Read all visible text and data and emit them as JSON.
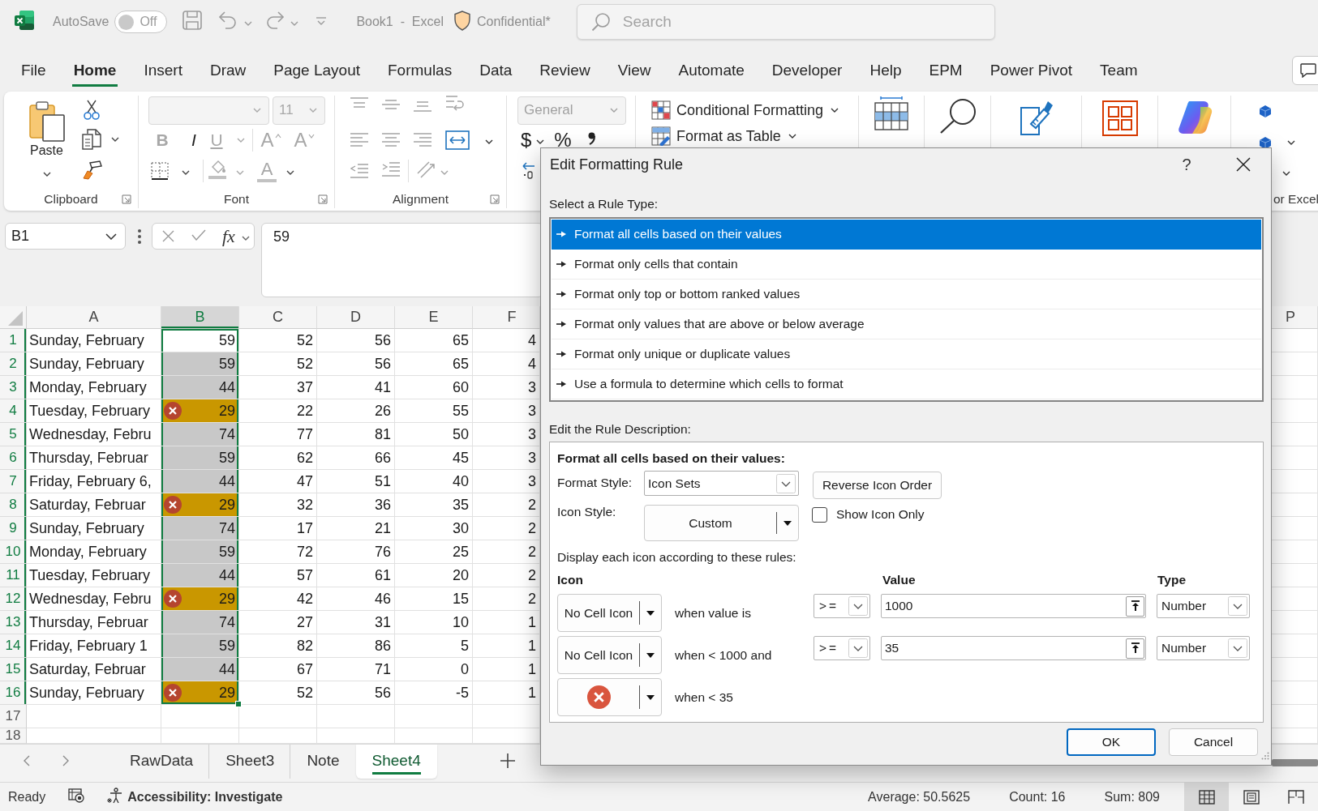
{
  "title_bar": {
    "autosave": {
      "label": "AutoSave",
      "on": false,
      "state_label": "Off"
    },
    "document": "Book1  -  Excel",
    "sensitivity": "Confidential*",
    "search": {
      "placeholder": "Search"
    }
  },
  "ribbon_tabs": [
    {
      "label": "File",
      "selected": false
    },
    {
      "label": "Home",
      "selected": true
    },
    {
      "label": "Insert",
      "selected": false
    },
    {
      "label": "Draw",
      "selected": false
    },
    {
      "label": "Page Layout",
      "selected": false
    },
    {
      "label": "Formulas",
      "selected": false
    },
    {
      "label": "Data",
      "selected": false
    },
    {
      "label": "Review",
      "selected": false
    },
    {
      "label": "View",
      "selected": false
    },
    {
      "label": "Automate",
      "selected": false
    },
    {
      "label": "Developer",
      "selected": false
    },
    {
      "label": "Help",
      "selected": false
    },
    {
      "label": "EPM",
      "selected": false
    },
    {
      "label": "Power Pivot",
      "selected": false
    },
    {
      "label": "Team",
      "selected": false
    }
  ],
  "ribbon": {
    "groups": [
      {
        "kind": "clipboard",
        "label": "Clipboard",
        "paste": "Paste"
      },
      {
        "kind": "font",
        "label": "Font",
        "disabled": true,
        "size": "11",
        "styles": [
          "B",
          "I",
          "U"
        ],
        "sizers": [
          "A",
          "A"
        ],
        "color_glyph": "A"
      },
      {
        "kind": "alignment",
        "label": "Alignment",
        "disabled": true
      },
      {
        "kind": "number",
        "format": {
          "value": "General",
          "disabled": true
        },
        "symbols": [
          "$",
          "%"
        ]
      },
      {
        "kind": "styles",
        "commands": [
          "Conditional Formatting",
          "Format as Table"
        ]
      },
      {
        "kind": "cells"
      },
      {
        "kind": "editing"
      },
      {
        "kind": "sensitivity"
      },
      {
        "kind": "addins"
      },
      {
        "kind": "copilot"
      },
      {
        "kind": "extension",
        "label": "or Excel"
      }
    ]
  },
  "formula_bar": {
    "name_box": "B1",
    "function_label": "fx",
    "formula": "59"
  },
  "grid": {
    "columns": [
      {
        "label": "A",
        "selected": false
      },
      {
        "label": "B",
        "selected": true
      },
      {
        "label": "C",
        "selected": false
      },
      {
        "label": "D",
        "selected": false
      },
      {
        "label": "E",
        "selected": false
      },
      {
        "label": "F",
        "selected": false
      }
    ],
    "far_columns": [
      {
        "label": "P",
        "selected": false
      }
    ],
    "rows": [
      {
        "label": "1",
        "selected": true,
        "cells": [
          "Sunday, February",
          {
            "value": "59",
            "flagged": false
          },
          "52",
          "56",
          "65",
          "4"
        ]
      },
      {
        "label": "2",
        "selected": true,
        "cells": [
          "Sunday, February",
          {
            "value": "59",
            "flagged": false
          },
          "52",
          "56",
          "65",
          "4"
        ]
      },
      {
        "label": "3",
        "selected": true,
        "cells": [
          "Monday, February",
          {
            "value": "44",
            "flagged": false
          },
          "37",
          "41",
          "60",
          "3"
        ]
      },
      {
        "label": "4",
        "selected": true,
        "cells": [
          "Tuesday, February",
          {
            "value": "29",
            "flagged": true
          },
          "22",
          "26",
          "55",
          "3"
        ]
      },
      {
        "label": "5",
        "selected": true,
        "cells": [
          "Wednesday, Febru",
          {
            "value": "74",
            "flagged": false
          },
          "77",
          "81",
          "50",
          "3"
        ]
      },
      {
        "label": "6",
        "selected": true,
        "cells": [
          "Thursday, Februar",
          {
            "value": "59",
            "flagged": false
          },
          "62",
          "66",
          "45",
          "3"
        ]
      },
      {
        "label": "7",
        "selected": true,
        "cells": [
          "Friday, February 6,",
          {
            "value": "44",
            "flagged": false
          },
          "47",
          "51",
          "40",
          "3"
        ]
      },
      {
        "label": "8",
        "selected": true,
        "cells": [
          "Saturday, Februar",
          {
            "value": "29",
            "flagged": true
          },
          "32",
          "36",
          "35",
          "2"
        ]
      },
      {
        "label": "9",
        "selected": true,
        "cells": [
          "Sunday, February",
          {
            "value": "74",
            "flagged": false
          },
          "17",
          "21",
          "30",
          "2"
        ]
      },
      {
        "label": "10",
        "selected": true,
        "cells": [
          "Monday, February",
          {
            "value": "59",
            "flagged": false
          },
          "72",
          "76",
          "25",
          "2"
        ]
      },
      {
        "label": "11",
        "selected": true,
        "cells": [
          "Tuesday, February",
          {
            "value": "44",
            "flagged": false
          },
          "57",
          "61",
          "20",
          "2"
        ]
      },
      {
        "label": "12",
        "selected": true,
        "cells": [
          "Wednesday, Febru",
          {
            "value": "29",
            "flagged": true
          },
          "42",
          "46",
          "15",
          "2"
        ]
      },
      {
        "label": "13",
        "selected": true,
        "cells": [
          "Thursday, Februar",
          {
            "value": "74",
            "flagged": false
          },
          "27",
          "31",
          "10",
          "1"
        ]
      },
      {
        "label": "14",
        "selected": true,
        "cells": [
          "Friday, February 1",
          {
            "value": "59",
            "flagged": false
          },
          "82",
          "86",
          "5",
          "1"
        ]
      },
      {
        "label": "15",
        "selected": true,
        "cells": [
          "Saturday, Februar",
          {
            "value": "44",
            "flagged": false
          },
          "67",
          "71",
          "0",
          "1"
        ]
      },
      {
        "label": "16",
        "selected": true,
        "cells": [
          "Sunday, February",
          {
            "value": "29",
            "flagged": true
          },
          "52",
          "56",
          "-5",
          "1"
        ]
      },
      {
        "label": "17",
        "selected": false
      },
      {
        "label": "18",
        "selected": false
      }
    ]
  },
  "sheet_tabs": [
    {
      "label": "RawData",
      "selected": false
    },
    {
      "label": "Sheet3",
      "selected": false
    },
    {
      "label": "Note",
      "selected": false
    },
    {
      "label": "Sheet4",
      "selected": true
    }
  ],
  "status_bar": {
    "mode": "Ready",
    "accessibility": "Accessibility: Investigate",
    "stats": [
      "Average: 50.5625",
      "Count: 16",
      "Sum: 809"
    ],
    "views": [
      {
        "kind": "normal",
        "selected": true
      },
      {
        "kind": "page_layout",
        "selected": false
      },
      {
        "kind": "page_break",
        "selected": false
      }
    ]
  },
  "dialog": {
    "title": "Edit Formatting Rule",
    "help": "?",
    "rule_type": {
      "label": "Select a Rule Type:",
      "options": [
        {
          "label": "Format all cells based on their values",
          "selected": true
        },
        {
          "label": "Format only cells that contain",
          "selected": false
        },
        {
          "label": "Format only top or bottom ranked values",
          "selected": false
        },
        {
          "label": "Format only values that are above or below average",
          "selected": false
        },
        {
          "label": "Format only unique or duplicate values",
          "selected": false
        },
        {
          "label": "Use a formula to determine which cells to format",
          "selected": false
        }
      ]
    },
    "description": {
      "label": "Edit the Rule Description:",
      "heading": "Format all cells based on their values:",
      "format_style": {
        "label": "Format Style:",
        "value": "Icon Sets"
      },
      "reverse_button": {
        "label": "Reverse Icon Order"
      },
      "icon_style": {
        "label": "Icon Style:",
        "value": "Custom"
      },
      "show_icon_only": {
        "label": "Show Icon Only",
        "checked": false
      },
      "rules_intro": "Display each icon according to these rules:",
      "columns": [
        {
          "label": "Icon"
        },
        {
          "label": "Value"
        },
        {
          "label": "Type"
        }
      ],
      "rules": [
        {
          "icon": {
            "kind": "none",
            "label": "No Cell Icon"
          },
          "condition": "when value is",
          "operator": ">=",
          "value": "1000",
          "type": "Number"
        },
        {
          "icon": {
            "kind": "none",
            "label": "No Cell Icon"
          },
          "condition": "when < 1000 and",
          "operator": ">=",
          "value": "35",
          "type": "Number"
        },
        {
          "icon": {
            "kind": "cross"
          },
          "condition": "when < 35"
        }
      ]
    },
    "buttons": [
      {
        "label": "OK",
        "default": true
      },
      {
        "label": "Cancel",
        "default": false
      }
    ]
  }
}
